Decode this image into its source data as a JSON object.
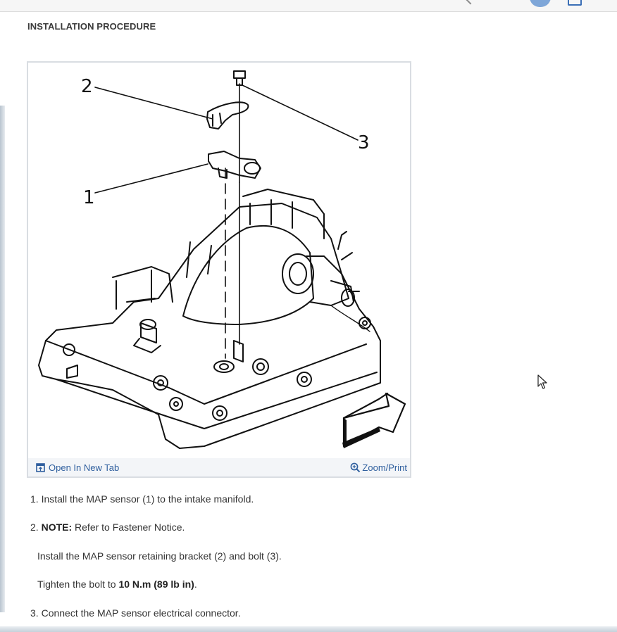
{
  "section": {
    "heading": "INSTALLATION PROCEDURE"
  },
  "figure": {
    "callouts": [
      "2",
      "3",
      "1"
    ],
    "open_tab_label": "Open In New Tab",
    "zoom_label": "Zoom/Print",
    "icons": {
      "open_tab": "external-window-icon",
      "zoom": "magnifier-plus-icon"
    }
  },
  "steps": {
    "s1": {
      "number": "1.",
      "text": "Install the MAP sensor (1) to the intake manifold."
    },
    "s2": {
      "number": "2.",
      "note_label": "NOTE:",
      "note_text": "Refer to Fastener Notice.",
      "sub1": "Install the MAP sensor retaining bracket (2) and bolt (3).",
      "sub2_prefix": "Tighten the bolt to",
      "sub2_value": "10 N.m (89 lb in)",
      "sub2_suffix": "."
    },
    "s3": {
      "number": "3.",
      "text": "Connect the MAP sensor electrical connector."
    }
  },
  "colors": {
    "link": "#2f5f9e",
    "avatar": "#7ea6d8",
    "footer_bg": "#f3f5f8"
  }
}
